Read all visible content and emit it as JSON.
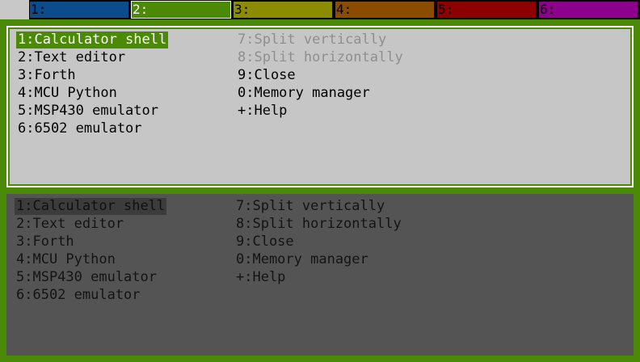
{
  "tabs": [
    {
      "label": "1:",
      "color": "#0c4c8c",
      "active": false
    },
    {
      "label": "2:",
      "color": "#4a8a06",
      "active": true
    },
    {
      "label": "3:",
      "color": "#8c8c00",
      "active": false
    },
    {
      "label": "4:",
      "color": "#8c4c00",
      "active": false
    },
    {
      "label": "5:",
      "color": "#8c0000",
      "active": false
    },
    {
      "label": "6:",
      "color": "#8c008c",
      "active": false
    }
  ],
  "menu": {
    "left": [
      "1:Calculator shell",
      "2:Text editor",
      "3:Forth",
      "4:MCU Python",
      "5:MSP430 emulator",
      "6:6502 emulator"
    ],
    "right": [
      "7:Split vertically",
      "8:Split horizontally",
      "9:Close",
      "0:Memory manager",
      "+:Help"
    ]
  },
  "colors": {
    "accent": "#4a8a06",
    "active_pane_bg": "#c6c6c6",
    "inactive_pane_bg": "#545454",
    "disabled_text": "#8f8f8f"
  }
}
